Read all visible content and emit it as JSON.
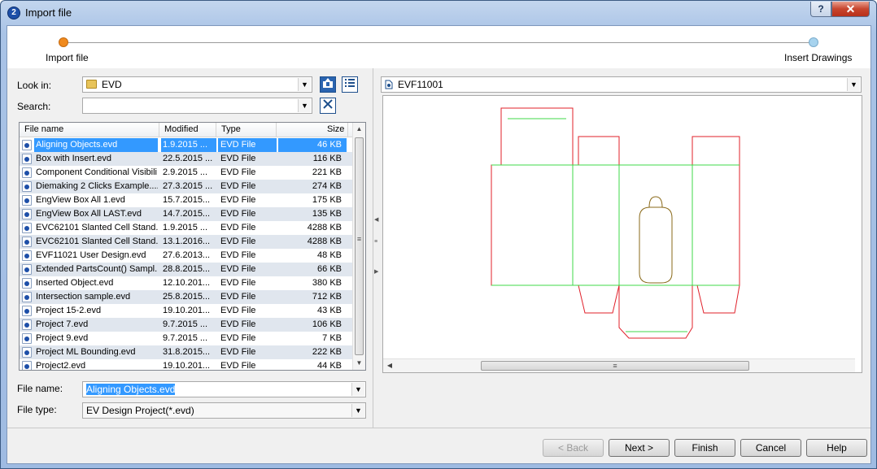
{
  "window": {
    "title": "Import file",
    "help_glyph": "?",
    "close_glyph": "✕",
    "app_icon_glyph": "2"
  },
  "wizard": {
    "steps": [
      {
        "label": "Import file",
        "state": "current",
        "color": "#f08a1e"
      },
      {
        "label": "Insert Drawings",
        "state": "pending",
        "color": "#a7d3ee"
      }
    ]
  },
  "look_in": {
    "label": "Look in:",
    "value": "EVD"
  },
  "search": {
    "label": "Search:",
    "value": ""
  },
  "list": {
    "columns": [
      "File name",
      "Modified",
      "Type",
      "Size"
    ],
    "rows": [
      {
        "name": "Aligning Objects.evd",
        "modified": "1.9.2015 ...",
        "type": "EVD File",
        "size": "46 KB",
        "selected": true
      },
      {
        "name": "Box with Insert.evd",
        "modified": "22.5.2015 ...",
        "type": "EVD File",
        "size": "116 KB"
      },
      {
        "name": "Component Conditional Visibili...",
        "modified": "2.9.2015 ...",
        "type": "EVD File",
        "size": "221 KB"
      },
      {
        "name": "Diemaking 2 Clicks Example....",
        "modified": "27.3.2015 ...",
        "type": "EVD File",
        "size": "274 KB"
      },
      {
        "name": "EngView Box All 1.evd",
        "modified": "15.7.2015...",
        "type": "EVD File",
        "size": "175 KB"
      },
      {
        "name": "EngView Box All LAST.evd",
        "modified": "14.7.2015...",
        "type": "EVD File",
        "size": "135 KB"
      },
      {
        "name": "EVC62101 Slanted Cell Stand...",
        "modified": "1.9.2015 ...",
        "type": "EVD File",
        "size": "4288 KB"
      },
      {
        "name": "EVC62101 Slanted Cell Stand...",
        "modified": "13.1.2016...",
        "type": "EVD File",
        "size": "4288 KB"
      },
      {
        "name": "EVF11021 User Design.evd",
        "modified": "27.6.2013...",
        "type": "EVD File",
        "size": "48 KB"
      },
      {
        "name": "Extended PartsCount() Sampl...",
        "modified": "28.8.2015...",
        "type": "EVD File",
        "size": "66 KB"
      },
      {
        "name": "Inserted Object.evd",
        "modified": "12.10.201...",
        "type": "EVD File",
        "size": "380 KB"
      },
      {
        "name": "Intersection sample.evd",
        "modified": "25.8.2015...",
        "type": "EVD File",
        "size": "712 KB"
      },
      {
        "name": "Project 15-2.evd",
        "modified": "19.10.201...",
        "type": "EVD File",
        "size": "43 KB"
      },
      {
        "name": "Project 7.evd",
        "modified": "9.7.2015 ...",
        "type": "EVD File",
        "size": "106 KB"
      },
      {
        "name": "Project 9.evd",
        "modified": "9.7.2015 ...",
        "type": "EVD File",
        "size": "7 KB"
      },
      {
        "name": "Project ML Bounding.evd",
        "modified": "31.8.2015...",
        "type": "EVD File",
        "size": "222 KB"
      },
      {
        "name": "Project2.evd",
        "modified": "19.10.201...",
        "type": "EVD File",
        "size": "44 KB"
      }
    ]
  },
  "file_name": {
    "label": "File name:",
    "value": "Aligning Objects.evd"
  },
  "file_type": {
    "label": "File type:",
    "value": "EV Design Project(*.evd)"
  },
  "preview": {
    "selector_value": "EVF11001",
    "cut_color": "#e0202a",
    "crease_color": "#3fd84a",
    "window_color": "#8a6a1a"
  },
  "buttons": {
    "back": "< Back",
    "next": "Next >",
    "finish": "Finish",
    "cancel": "Cancel",
    "help": "Help"
  },
  "icons": {
    "folder": "folder-icon",
    "up_folder": "up-folder-icon",
    "view_list": "view-list-icon",
    "clear": "clear-icon",
    "file": "evd-file-icon",
    "combo_arrow": "▼",
    "scroll_up": "▲",
    "scroll_down": "▼",
    "scroll_left": "◀",
    "scroll_right": "▶",
    "grip": "≡"
  }
}
